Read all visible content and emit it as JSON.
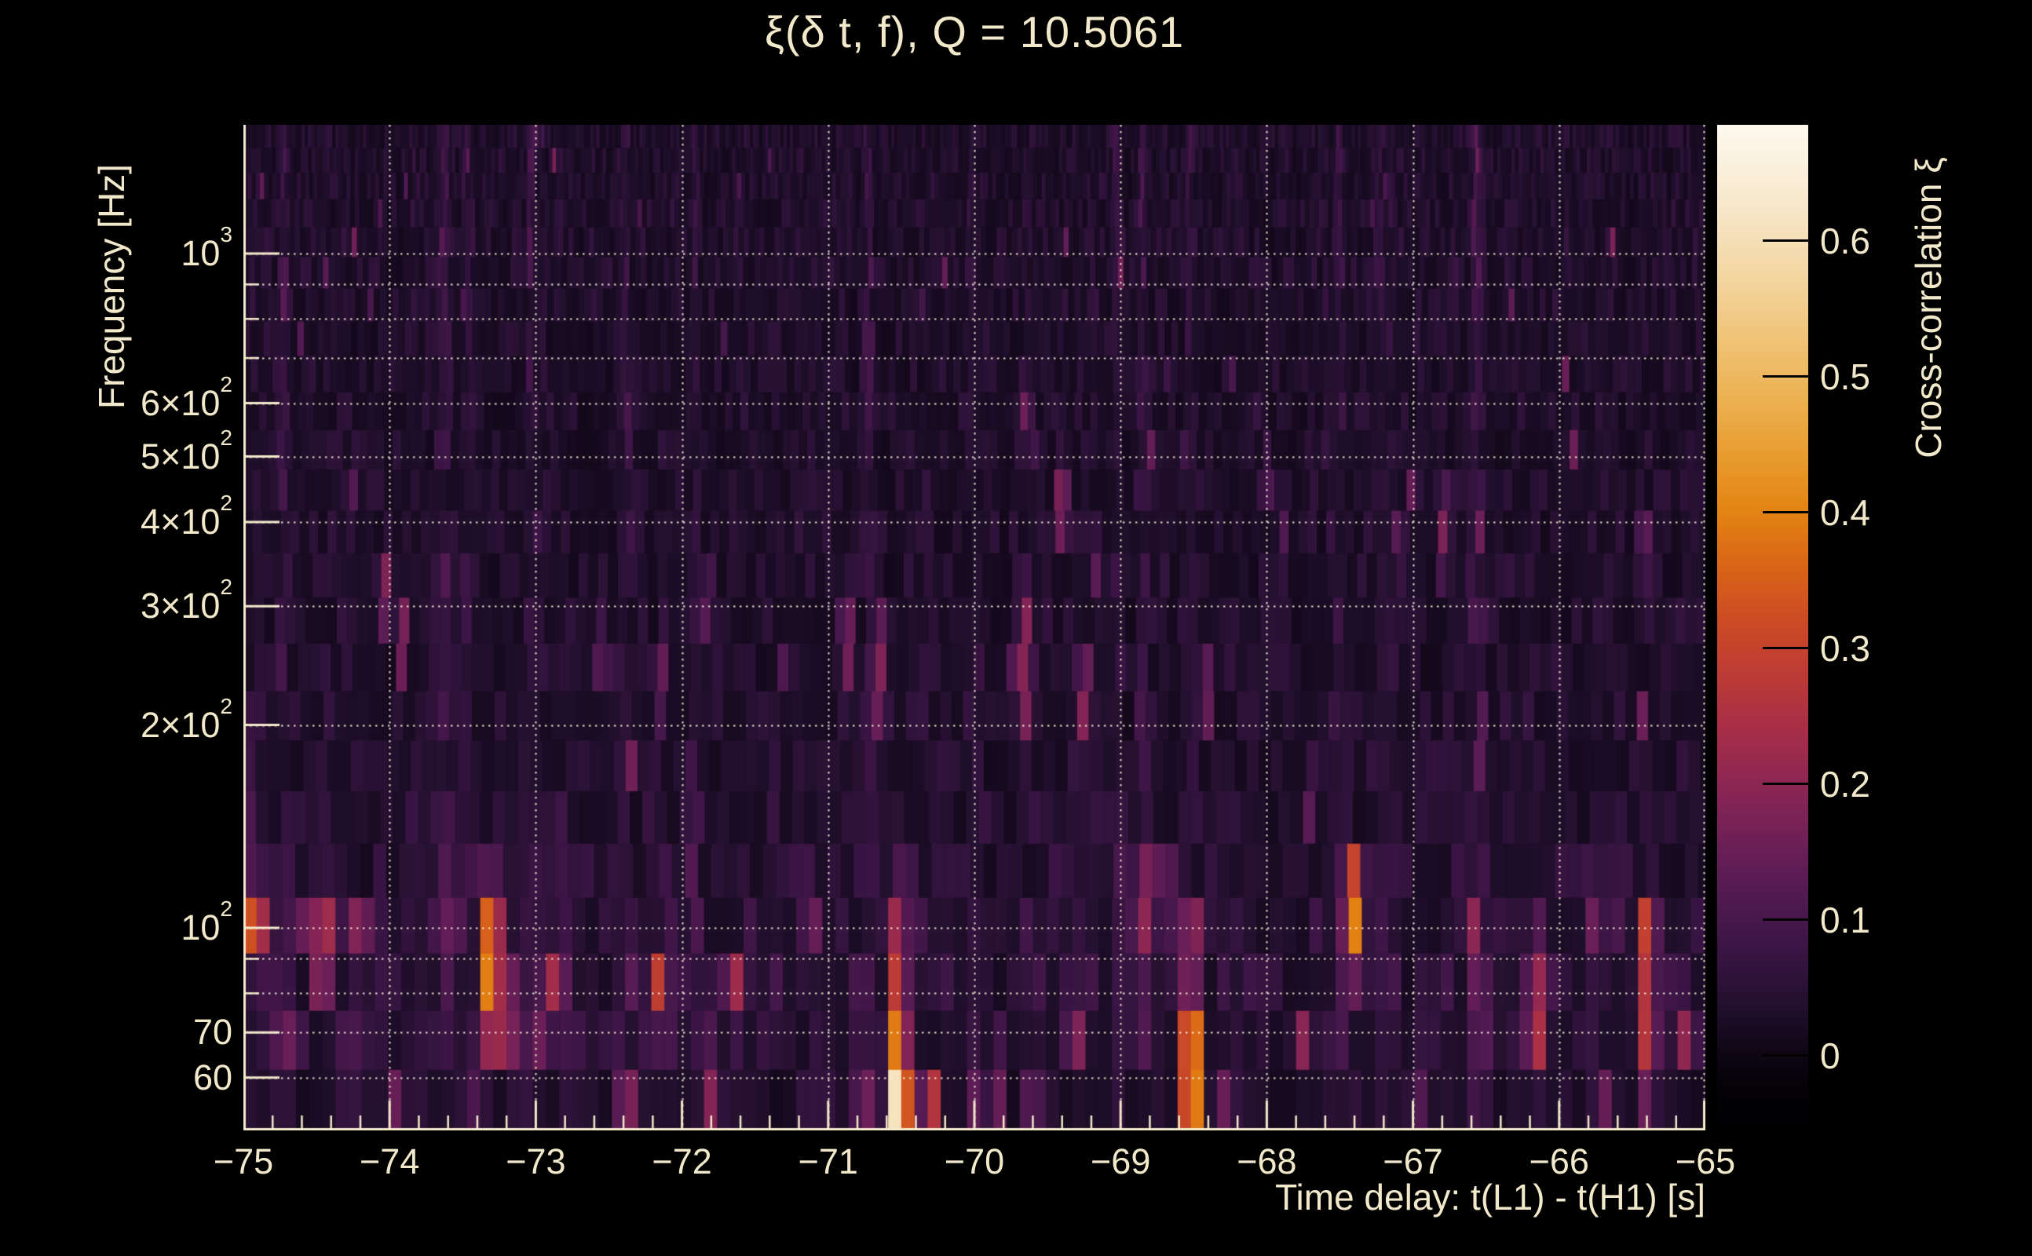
{
  "palette": {
    "background": "#000000",
    "text": "#f2e8ca",
    "grid": "#f7f0dd",
    "axis": "#f3eacb"
  },
  "chart_data": {
    "type": "heatmap",
    "title": "ξ(δ t, f), Q = 10.5061",
    "xlabel": "Time delay: t(L1) - t(H1) [s]",
    "ylabel": "Frequency [Hz]",
    "colorbar_label": "Cross-correlation ξ",
    "x_range": [
      -75,
      -65
    ],
    "x_minor_step": 0.2,
    "x_ticks": [
      {
        "t": -75,
        "label": "−75"
      },
      {
        "t": -74,
        "label": "−74"
      },
      {
        "t": -73,
        "label": "−73"
      },
      {
        "t": -72,
        "label": "−72"
      },
      {
        "t": -71,
        "label": "−71"
      },
      {
        "t": -70,
        "label": "−70"
      },
      {
        "t": -69,
        "label": "−69"
      },
      {
        "t": -68,
        "label": "−68"
      },
      {
        "t": -67,
        "label": "−67"
      },
      {
        "t": -66,
        "label": "−66"
      },
      {
        "t": -65,
        "label": "−65"
      }
    ],
    "y_scale": "log",
    "y_range_hz": [
      50.1,
      1552
    ],
    "y_ticks": [
      {
        "f": 1000,
        "m": "10",
        "e": "3"
      },
      {
        "f": 600,
        "m": "6×10",
        "e": "2"
      },
      {
        "f": 500,
        "m": "5×10",
        "e": "2"
      },
      {
        "f": 400,
        "m": "4×10",
        "e": "2"
      },
      {
        "f": 300,
        "m": "3×10",
        "e": "2"
      },
      {
        "f": 200,
        "m": "2×10",
        "e": "2"
      },
      {
        "f": 100,
        "m": "10",
        "e": "2"
      },
      {
        "f": 70,
        "m": "70",
        "e": null
      },
      {
        "f": 60,
        "m": "60",
        "e": null
      }
    ],
    "y_minor_ticks_hz": [
      80,
      90,
      700,
      800,
      900
    ],
    "grid_hz": [
      60,
      70,
      80,
      90,
      100,
      200,
      300,
      400,
      500,
      600,
      700,
      800,
      900,
      1000
    ],
    "grid_on": true,
    "colorbar": {
      "vmin": -0.0526,
      "vmax": 0.6855,
      "ticks": [
        {
          "v": 0.0,
          "label": "0"
        },
        {
          "v": 0.1,
          "label": "0.1"
        },
        {
          "v": 0.2,
          "label": "0.2"
        },
        {
          "v": 0.3,
          "label": "0.3"
        },
        {
          "v": 0.4,
          "label": "0.4"
        },
        {
          "v": 0.5,
          "label": "0.5"
        },
        {
          "v": 0.6,
          "label": "0.6"
        }
      ],
      "stops": [
        [
          -0.0526,
          "#000002"
        ],
        [
          -0.02,
          "#050208"
        ],
        [
          0.0,
          "#0e0614"
        ],
        [
          0.04,
          "#23102f"
        ],
        [
          0.08,
          "#3b1544"
        ],
        [
          0.12,
          "#531a52"
        ],
        [
          0.16,
          "#6f2057"
        ],
        [
          0.2,
          "#8c2653"
        ],
        [
          0.24,
          "#a62e47"
        ],
        [
          0.28,
          "#bc3b35"
        ],
        [
          0.32,
          "#cc4b24"
        ],
        [
          0.36,
          "#d96418"
        ],
        [
          0.4,
          "#e28313"
        ],
        [
          0.44,
          "#e89b2d"
        ],
        [
          0.48,
          "#ecaf4e"
        ],
        [
          0.52,
          "#efc070"
        ],
        [
          0.56,
          "#f2d094"
        ],
        [
          0.6,
          "#f5dfb7"
        ],
        [
          0.64,
          "#f9ecd4"
        ],
        [
          0.6855,
          "#fdf8ee"
        ]
      ]
    },
    "hotspots": [
      [
        -75.0,
        90,
        120,
        0.32
      ],
      [
        -74.92,
        88,
        118,
        0.36
      ],
      [
        -74.72,
        60,
        76,
        0.18
      ],
      [
        -74.62,
        95,
        112,
        0.2
      ],
      [
        -74.46,
        80,
        108,
        0.34
      ],
      [
        -74.28,
        56,
        70,
        0.2
      ],
      [
        -74.2,
        86,
        108,
        0.24
      ],
      [
        -74.03,
        260,
        360,
        0.16
      ],
      [
        -73.95,
        52,
        62,
        0.18
      ],
      [
        -73.55,
        95,
        115,
        0.18
      ],
      [
        -73.43,
        50,
        57,
        0.18
      ],
      [
        -73.31,
        68,
        118,
        0.46
      ],
      [
        -73.2,
        64,
        86,
        0.34
      ],
      [
        -73.0,
        60,
        85,
        0.2
      ],
      [
        -72.88,
        70,
        92,
        0.22
      ],
      [
        -72.55,
        220,
        290,
        0.15
      ],
      [
        -72.38,
        52,
        62,
        0.26
      ],
      [
        -72.16,
        70,
        92,
        0.3
      ],
      [
        -72.15,
        200,
        260,
        0.15
      ],
      [
        -71.83,
        265,
        350,
        0.13
      ],
      [
        -71.8,
        50,
        66,
        0.22
      ],
      [
        -71.65,
        70,
        92,
        0.22
      ],
      [
        -71.3,
        230,
        272,
        0.15
      ],
      [
        -71.12,
        94,
        115,
        0.2
      ],
      [
        -70.87,
        210,
        330,
        0.17
      ],
      [
        -70.75,
        52,
        62,
        0.22
      ],
      [
        -70.65,
        195,
        300,
        0.2
      ],
      [
        -70.52,
        48,
        63,
        0.72
      ],
      [
        -70.52,
        63,
        86,
        0.45
      ],
      [
        -70.52,
        86,
        122,
        0.22
      ],
      [
        -70.3,
        48,
        60,
        0.3
      ],
      [
        -70.0,
        50,
        58,
        0.22
      ],
      [
        -69.85,
        48,
        56,
        0.26
      ],
      [
        -69.65,
        520,
        660,
        0.17
      ],
      [
        -69.65,
        185,
        330,
        0.2
      ],
      [
        -69.6,
        48,
        56,
        0.3
      ],
      [
        -69.4,
        360,
        500,
        0.19
      ],
      [
        -69.3,
        60,
        76,
        0.2
      ],
      [
        -69.25,
        185,
        260,
        0.18
      ],
      [
        -68.85,
        95,
        125,
        0.3
      ],
      [
        -68.7,
        100,
        126,
        0.24
      ],
      [
        -68.52,
        48,
        78,
        0.5
      ],
      [
        -68.52,
        78,
        112,
        0.24
      ],
      [
        -68.42,
        195,
        260,
        0.16
      ],
      [
        -68.3,
        52,
        62,
        0.2
      ],
      [
        -68.0,
        420,
        520,
        0.13
      ],
      [
        -67.75,
        60,
        74,
        0.2
      ],
      [
        -67.41,
        85,
        128,
        0.44
      ],
      [
        -67.1,
        330,
        420,
        0.13
      ],
      [
        -66.95,
        55,
        66,
        0.2
      ],
      [
        -66.79,
        330,
        460,
        0.18
      ],
      [
        -66.6,
        95,
        115,
        0.2
      ],
      [
        -66.55,
        350,
        460,
        0.14
      ],
      [
        -66.16,
        58,
        100,
        0.26
      ],
      [
        -65.9,
        480,
        580,
        0.14
      ],
      [
        -65.75,
        90,
        108,
        0.2
      ],
      [
        -65.42,
        330,
        420,
        0.17
      ],
      [
        -65.4,
        55,
        112,
        0.3
      ],
      [
        -65.15,
        60,
        82,
        0.2
      ]
    ],
    "texture": {
      "seed": 9,
      "bucket_s": 0.02,
      "rows": 24,
      "row_growth": 0.07,
      "col_sec_top": 0.021,
      "col_growth": 0.17,
      "col_sec_max": 0.09,
      "streak_prob": 0.05,
      "band_gain": [
        [
          52,
          0.72
        ],
        [
          58,
          1.2
        ],
        [
          66,
          1.4
        ],
        [
          85,
          1.5
        ],
        [
          105,
          1.35
        ],
        [
          135,
          1.15
        ],
        [
          180,
          1.05
        ],
        [
          250,
          0.98
        ],
        [
          400,
          0.92
        ],
        [
          700,
          0.88
        ],
        [
          1000,
          1.0
        ],
        [
          1250,
          0.9
        ],
        [
          1552,
          0.92
        ]
      ]
    }
  }
}
